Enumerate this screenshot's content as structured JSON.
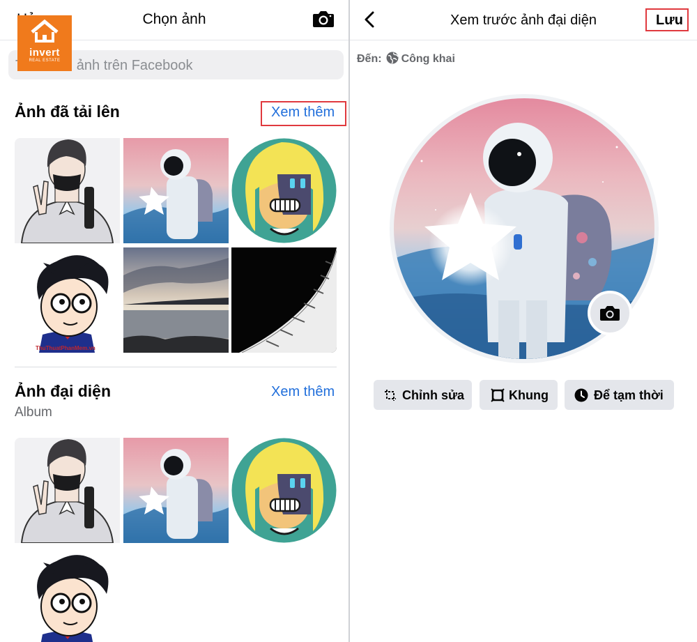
{
  "left": {
    "header": {
      "cancel_label": "Hủy",
      "title": "Chọn ảnh"
    },
    "search": {
      "placeholder": "Tìm kiếm ảnh trên Facebook"
    },
    "logo": {
      "text": "invert",
      "sub": "REAL ESTATE"
    },
    "uploaded": {
      "title": "Ảnh đã tải lên",
      "see_more": "Xem thêm"
    },
    "profile": {
      "title": "Ảnh đại diện",
      "subtitle": "Album",
      "see_more": "Xem thêm"
    },
    "watermark": "ThuThuatPhanMem.vn"
  },
  "right": {
    "header": {
      "title": "Xem trước ảnh đại diện",
      "save_label": "Lưu"
    },
    "audience": {
      "prefix": "Đến:",
      "value": "Công khai"
    },
    "actions": [
      {
        "label": "Chỉnh sửa",
        "icon": "crop-icon"
      },
      {
        "label": "Khung",
        "icon": "frame-icon"
      },
      {
        "label": "Để tạm thời",
        "icon": "clock-icon"
      }
    ]
  },
  "colors": {
    "link": "#216fdb",
    "highlight": "#e0393e",
    "logo": "#f07a1c",
    "pill": "#e4e6eb"
  }
}
